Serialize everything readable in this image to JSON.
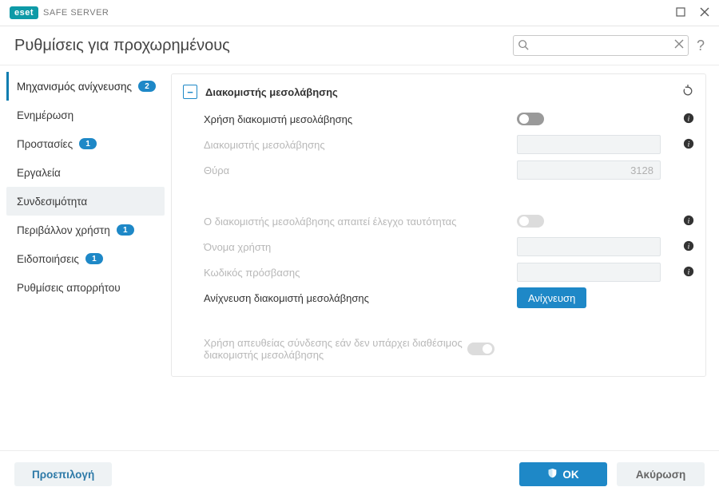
{
  "titlebar": {
    "brand_logo": "eset",
    "brand_text": "SAFE SERVER"
  },
  "header": {
    "title": "Ρυθμίσεις για προχωρημένους",
    "search_placeholder": ""
  },
  "sidebar": {
    "items": [
      {
        "label": "Μηχανισμός ανίχνευσης",
        "badge": "2",
        "active_branch": true
      },
      {
        "label": "Ενημέρωση"
      },
      {
        "label": "Προστασίες",
        "badge": "1"
      },
      {
        "label": "Εργαλεία"
      },
      {
        "label": "Συνδεσιμότητα",
        "selected": true
      },
      {
        "label": "Περιβάλλον χρήστη",
        "badge": "1"
      },
      {
        "label": "Ειδοποιήσεις",
        "badge": "1"
      },
      {
        "label": "Ρυθμίσεις απορρήτου"
      }
    ]
  },
  "panel": {
    "title": "Διακομιστής μεσολάβησης",
    "rows": {
      "use_proxy": {
        "label": "Χρήση διακομιστή μεσολάβησης",
        "on": false,
        "disabled": false
      },
      "proxy_server": {
        "label": "Διακομιστής μεσολάβησης",
        "value": "",
        "disabled": true
      },
      "port": {
        "label": "Θύρα",
        "value": "3128",
        "disabled": true
      },
      "requires_auth": {
        "label": "Ο διακομιστής μεσολάβησης απαιτεί έλεγχο ταυτότητας",
        "on": false,
        "disabled": true
      },
      "username": {
        "label": "Όνομα χρήστη",
        "value": "",
        "disabled": true
      },
      "password": {
        "label": "Κωδικός πρόσβασης",
        "value": "",
        "disabled": true
      },
      "detect": {
        "label": "Ανίχνευση διακομιστή μεσολάβησης",
        "button": "Ανίχνευση"
      },
      "direct_if_no_proxy": {
        "label": "Χρήση απευθείας σύνδεσης εάν δεν υπάρχει διαθέσιμος διακομιστής μεσολάβησης",
        "on": true,
        "disabled": true
      }
    }
  },
  "footer": {
    "default": "Προεπιλογή",
    "ok": "OK",
    "cancel": "Ακύρωση"
  }
}
